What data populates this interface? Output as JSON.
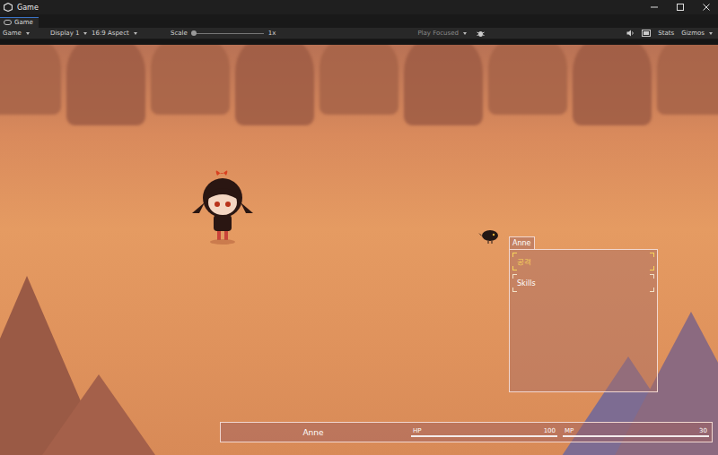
{
  "window": {
    "title": "Game"
  },
  "tabs": [
    {
      "label": "Game",
      "selected": true
    }
  ],
  "toolbar": {
    "view": "Game",
    "display": "Display 1",
    "aspect": "16:9 Aspect",
    "scale_label": "Scale",
    "scale_level": 0.0,
    "scale": "1x",
    "play_mode": "Play Focused",
    "stats": "Stats",
    "gizmos": "Gizmos"
  },
  "command_menu": {
    "title": "Anne",
    "items": [
      {
        "label": "공격",
        "selected": true
      },
      {
        "label": "Skills",
        "selected": false
      }
    ]
  },
  "status_bar": {
    "name": "Anne",
    "hp_label": "HP",
    "hp": "100",
    "hp_level": 1.0,
    "mp_label": "MP",
    "mp": "30",
    "mp_level": 1.0
  }
}
